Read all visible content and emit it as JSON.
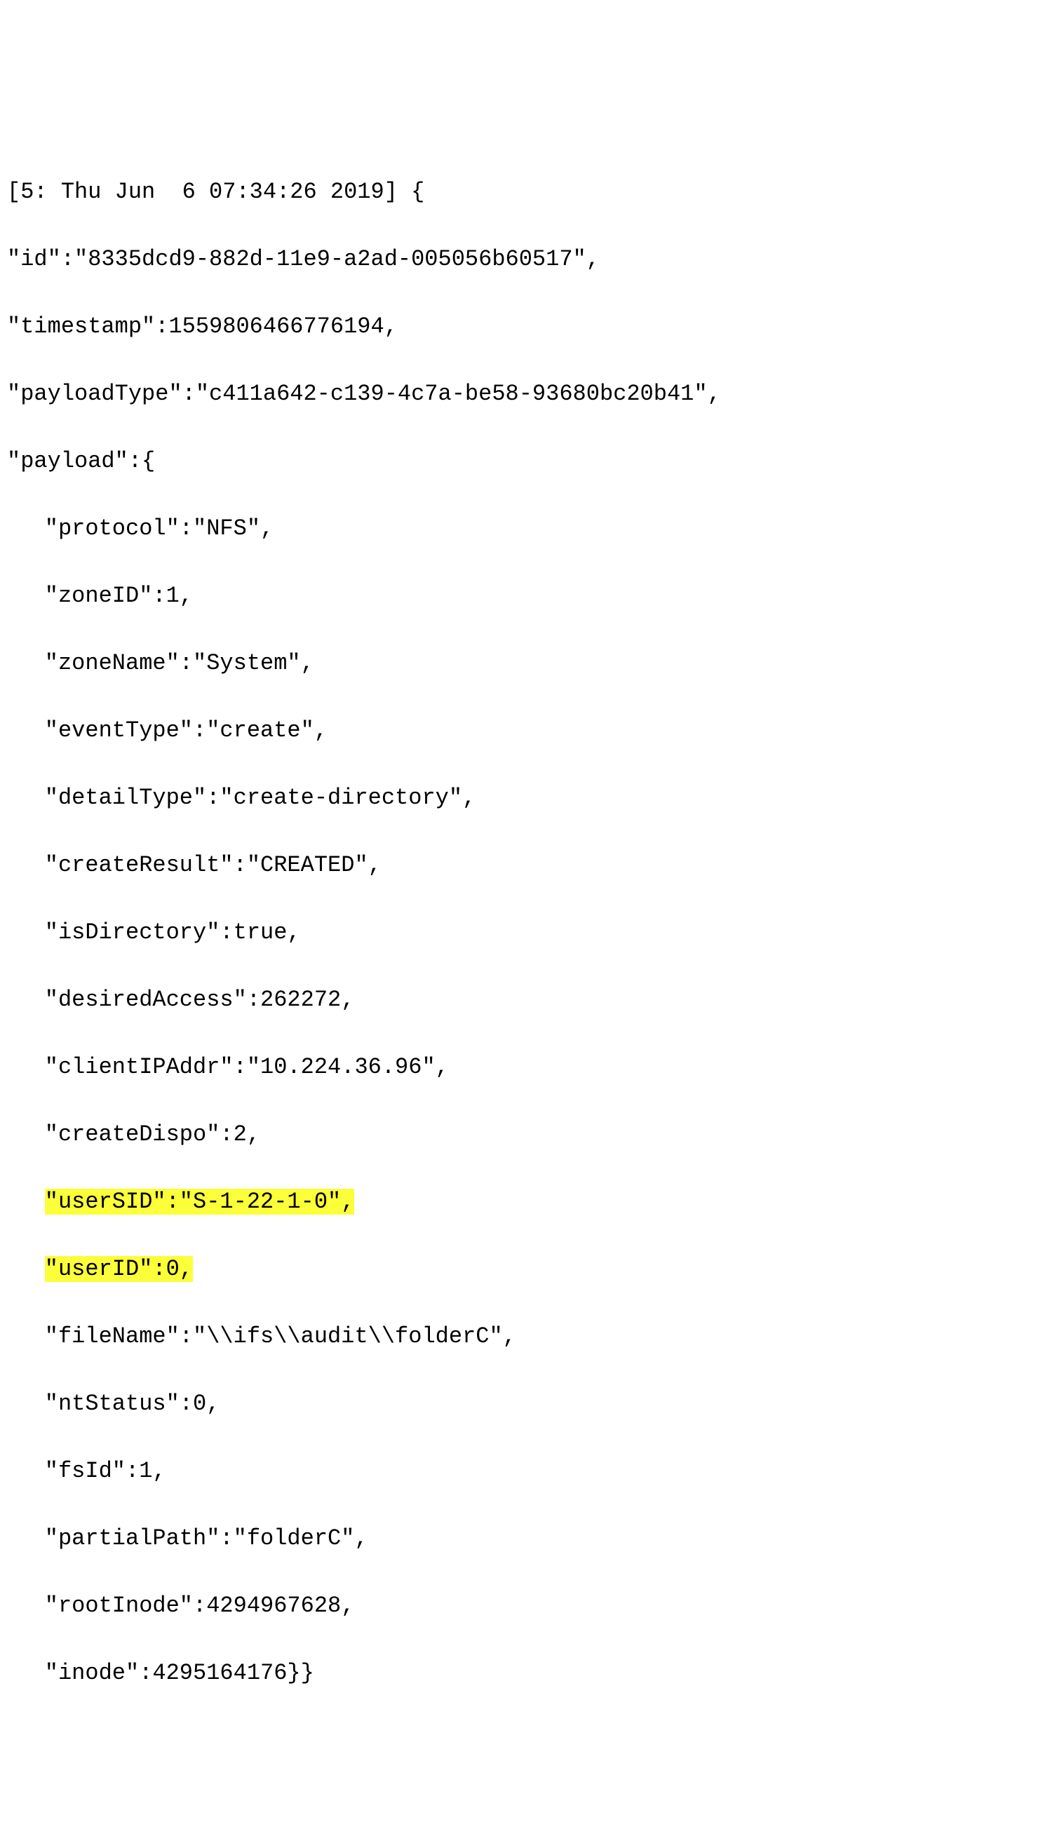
{
  "log": {
    "header": "[5: Thu Jun  6 07:34:26 2019] {",
    "id_line": "\"id\":\"8335dcd9-882d-11e9-a2ad-005056b60517\",",
    "timestamp_line": "\"timestamp\":1559806466776194,",
    "payloadType_line": "\"payloadType\":\"c411a642-c139-4c7a-be58-93680bc20b41\",",
    "payload_open": "\"payload\":{",
    "protocol": "\"protocol\":\"NFS\",",
    "zoneID": "\"zoneID\":1,",
    "zoneName": "\"zoneName\":\"System\",",
    "eventType": "\"eventType\":\"create\",",
    "detailType": "\"detailType\":\"create-directory\",",
    "createResult": "\"createResult\":\"CREATED\",",
    "isDirectory": "\"isDirectory\":true,",
    "desiredAccess": "\"desiredAccess\":262272,",
    "clientIPAddr": "\"clientIPAddr\":\"10.224.36.96\",",
    "createDispo": "\"createDispo\":2,",
    "userSID": "\"userSID\":\"S-1-22-1-0\",",
    "userID": "\"userID\":0,",
    "fileName": "\"fileName\":\"\\\\ifs\\\\audit\\\\folderC\",",
    "ntStatus": "\"ntStatus\":0,",
    "fsId": "\"fsId\":1,",
    "partialPath": "\"partialPath\":\"folderC\",",
    "rootInode": "\"rootInode\":4294967628,",
    "inode": "\"inode\":4295164176}}"
  }
}
